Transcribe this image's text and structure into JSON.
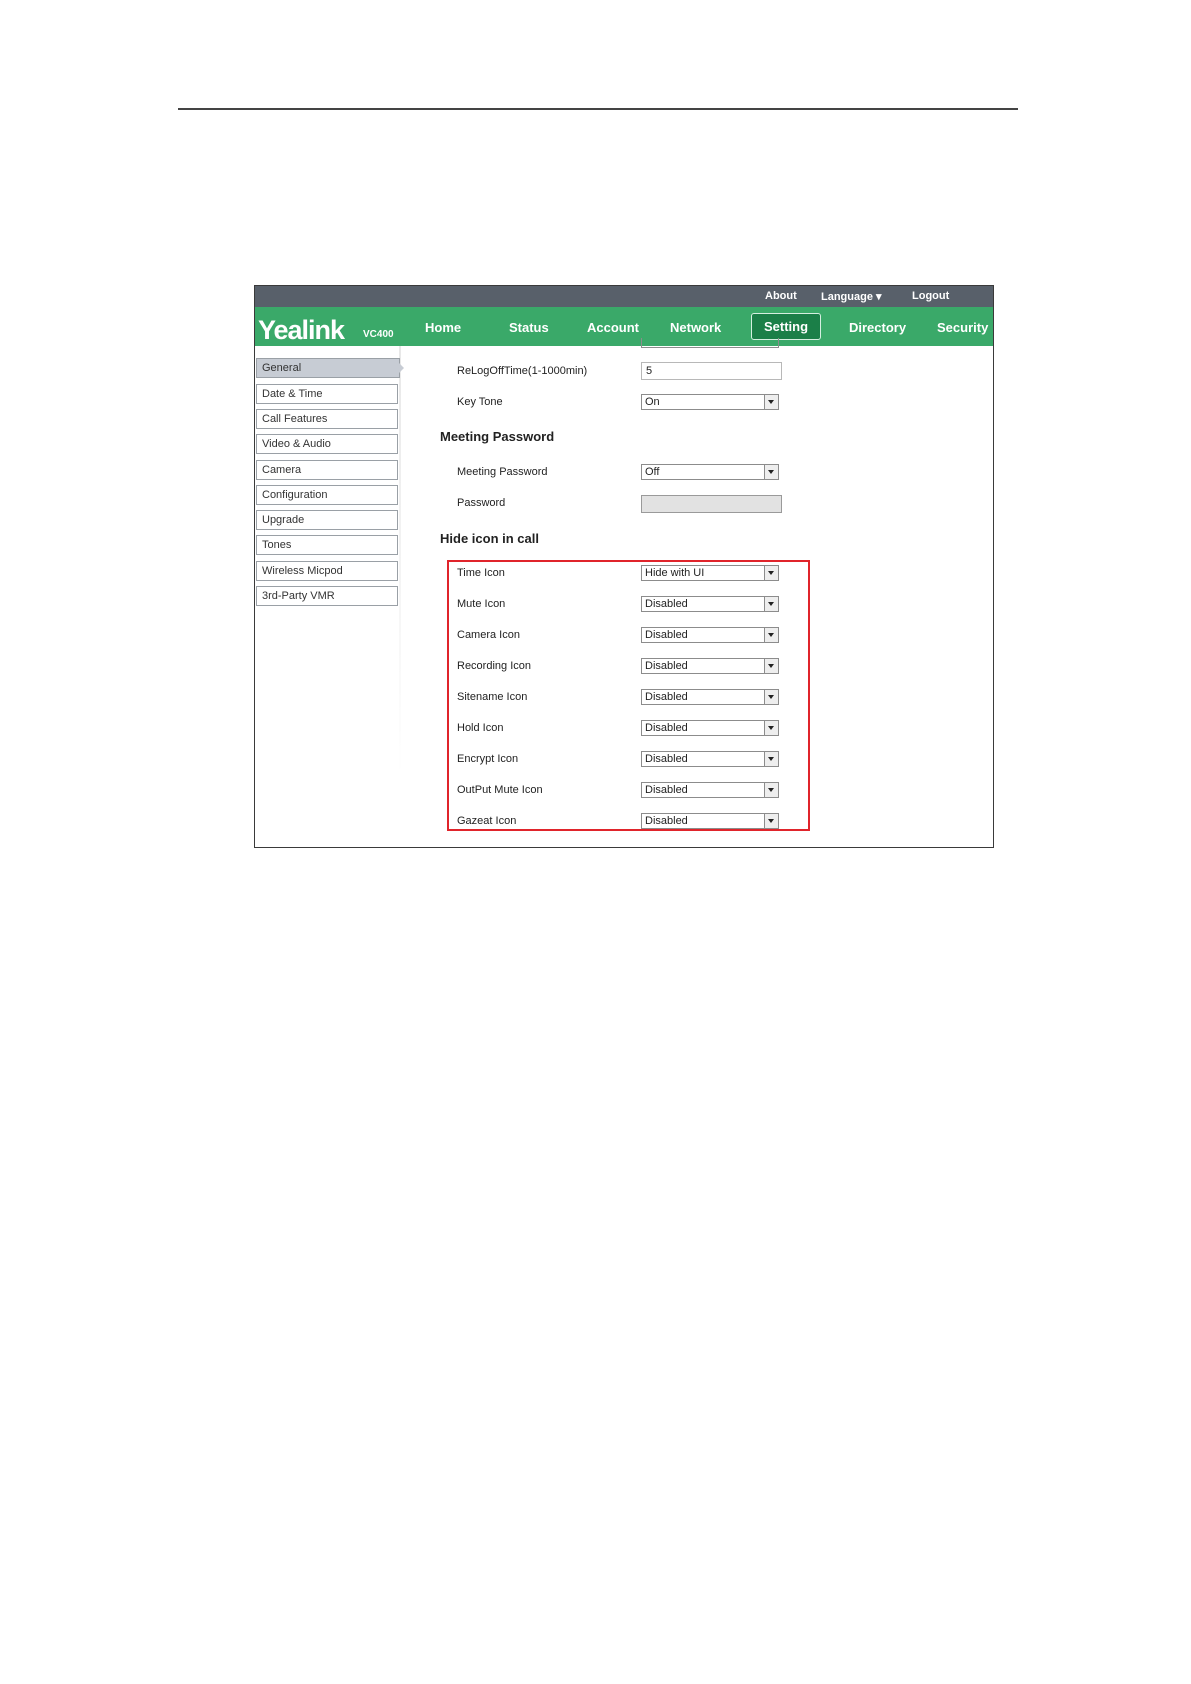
{
  "topbar": {
    "about": "About",
    "language": "Language ▾",
    "logout": "Logout"
  },
  "brand": {
    "logo": "Yealink",
    "model": "VC400"
  },
  "nav": [
    "Home",
    "Status",
    "Account",
    "Network",
    "Setting",
    "Directory",
    "Security"
  ],
  "nav_active": "Setting",
  "sidebar": {
    "items": [
      "General",
      "Date & Time",
      "Call Features",
      "Video & Audio",
      "Camera",
      "Configuration",
      "Upgrade",
      "Tones",
      "Wireless Micpod",
      "3rd-Party VMR"
    ],
    "active": "General"
  },
  "form": {
    "relogoff": {
      "label": "ReLogOffTime(1-1000min)",
      "value": "5"
    },
    "keytone": {
      "label": "Key Tone",
      "value": "On"
    },
    "meeting_section": "Meeting Password",
    "meeting_password": {
      "label": "Meeting Password",
      "value": "Off"
    },
    "password": {
      "label": "Password",
      "value": ""
    },
    "hide_section": "Hide icon in call",
    "hide_icons": [
      {
        "label": "Time Icon",
        "value": "Hide with UI"
      },
      {
        "label": "Mute Icon",
        "value": "Disabled"
      },
      {
        "label": "Camera Icon",
        "value": "Disabled"
      },
      {
        "label": "Recording Icon",
        "value": "Disabled"
      },
      {
        "label": "Sitename Icon",
        "value": "Disabled"
      },
      {
        "label": "Hold Icon",
        "value": "Disabled"
      },
      {
        "label": "Encrypt Icon",
        "value": "Disabled"
      },
      {
        "label": "OutPut Mute Icon",
        "value": "Disabled"
      },
      {
        "label": "Gazeat Icon",
        "value": "Disabled"
      }
    ]
  },
  "colors": {
    "nav_bg": "#3aa969",
    "topbar_bg": "#58606a",
    "highlight": "#e0242b"
  }
}
